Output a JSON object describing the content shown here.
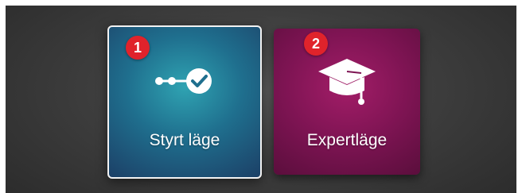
{
  "mode_picker": {
    "tiles": [
      {
        "badge": "1",
        "label": "Styrt läge",
        "icon": "progress-steps-check-icon",
        "color": "#1f6f8e",
        "selected": true
      },
      {
        "badge": "2",
        "label": "Expertläge",
        "icon": "graduation-cap-icon",
        "color": "#7e1453",
        "selected": false
      }
    ]
  }
}
